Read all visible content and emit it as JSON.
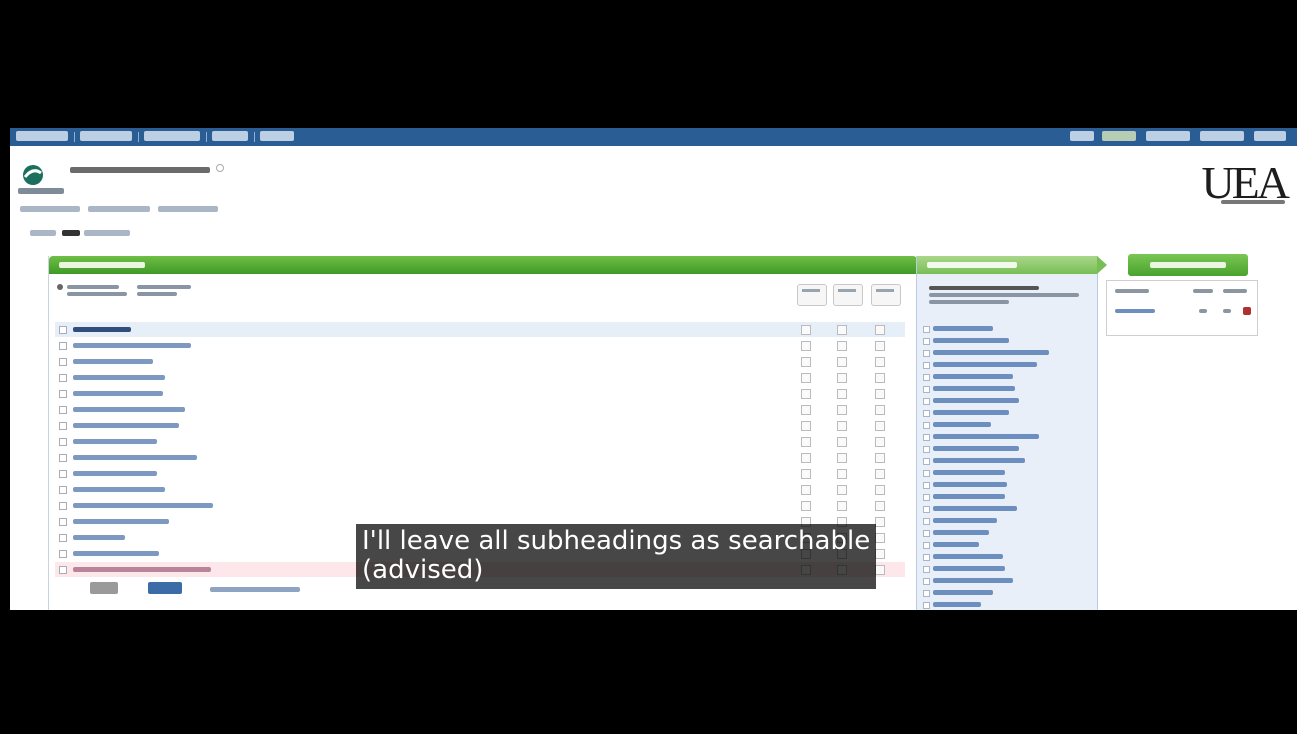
{
  "subtitle": {
    "line1": "I'll leave all subheadings as searchable",
    "line2": "(advised)"
  },
  "header": {
    "logo_text": "UEA"
  },
  "colors": {
    "nav_bar": "#2b5d95",
    "main_green": "#4aa22e",
    "sub_green": "#78be55",
    "subheading_panel_bg": "#e8eff8",
    "selected_row": "#e6eef8",
    "last_row": "#fde7ea",
    "letterbox": "#000000"
  },
  "icons": [
    "ovid-logo-icon",
    "help-icon",
    "checkbox-icon",
    "radio-icon"
  ]
}
